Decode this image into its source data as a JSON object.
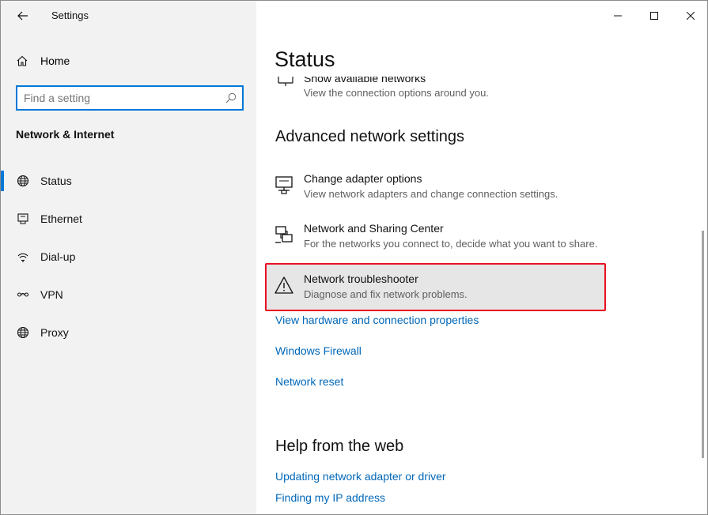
{
  "window": {
    "app_title": "Settings",
    "controls": {
      "minimize": "minimize-icon",
      "maximize": "maximize-icon",
      "close": "close-icon"
    }
  },
  "sidebar": {
    "home_label": "Home",
    "search_placeholder": "Find a setting",
    "section_title": "Network & Internet",
    "items": [
      {
        "label": "Status",
        "icon": "globe-icon",
        "active": true
      },
      {
        "label": "Ethernet",
        "icon": "ethernet-icon",
        "active": false
      },
      {
        "label": "Dial-up",
        "icon": "dialup-icon",
        "active": false
      },
      {
        "label": "VPN",
        "icon": "vpn-icon",
        "active": false
      },
      {
        "label": "Proxy",
        "icon": "globe-icon",
        "active": false
      }
    ]
  },
  "main": {
    "title": "Status",
    "partial_item": {
      "title": "Show available networks",
      "description": "View the connection options around you."
    },
    "advanced_heading": "Advanced network settings",
    "settings": [
      {
        "title": "Change adapter options",
        "description": "View network adapters and change connection settings.",
        "icon": "adapter-icon"
      },
      {
        "title": "Network and Sharing Center",
        "description": "For the networks you connect to, decide what you want to share.",
        "icon": "sharing-center-icon"
      },
      {
        "title": "Network troubleshooter",
        "description": "Diagnose and fix network problems.",
        "icon": "warning-icon"
      }
    ],
    "links": [
      "View hardware and connection properties",
      "Windows Firewall",
      "Network reset"
    ],
    "help_heading": "Help from the web",
    "help_links": [
      "Updating network adapter or driver",
      "Finding my IP address"
    ]
  },
  "colors": {
    "accent": "#0078d7",
    "link": "#0067b8",
    "highlight_border": "#e81123",
    "sidebar_bg": "#f2f2f2"
  }
}
